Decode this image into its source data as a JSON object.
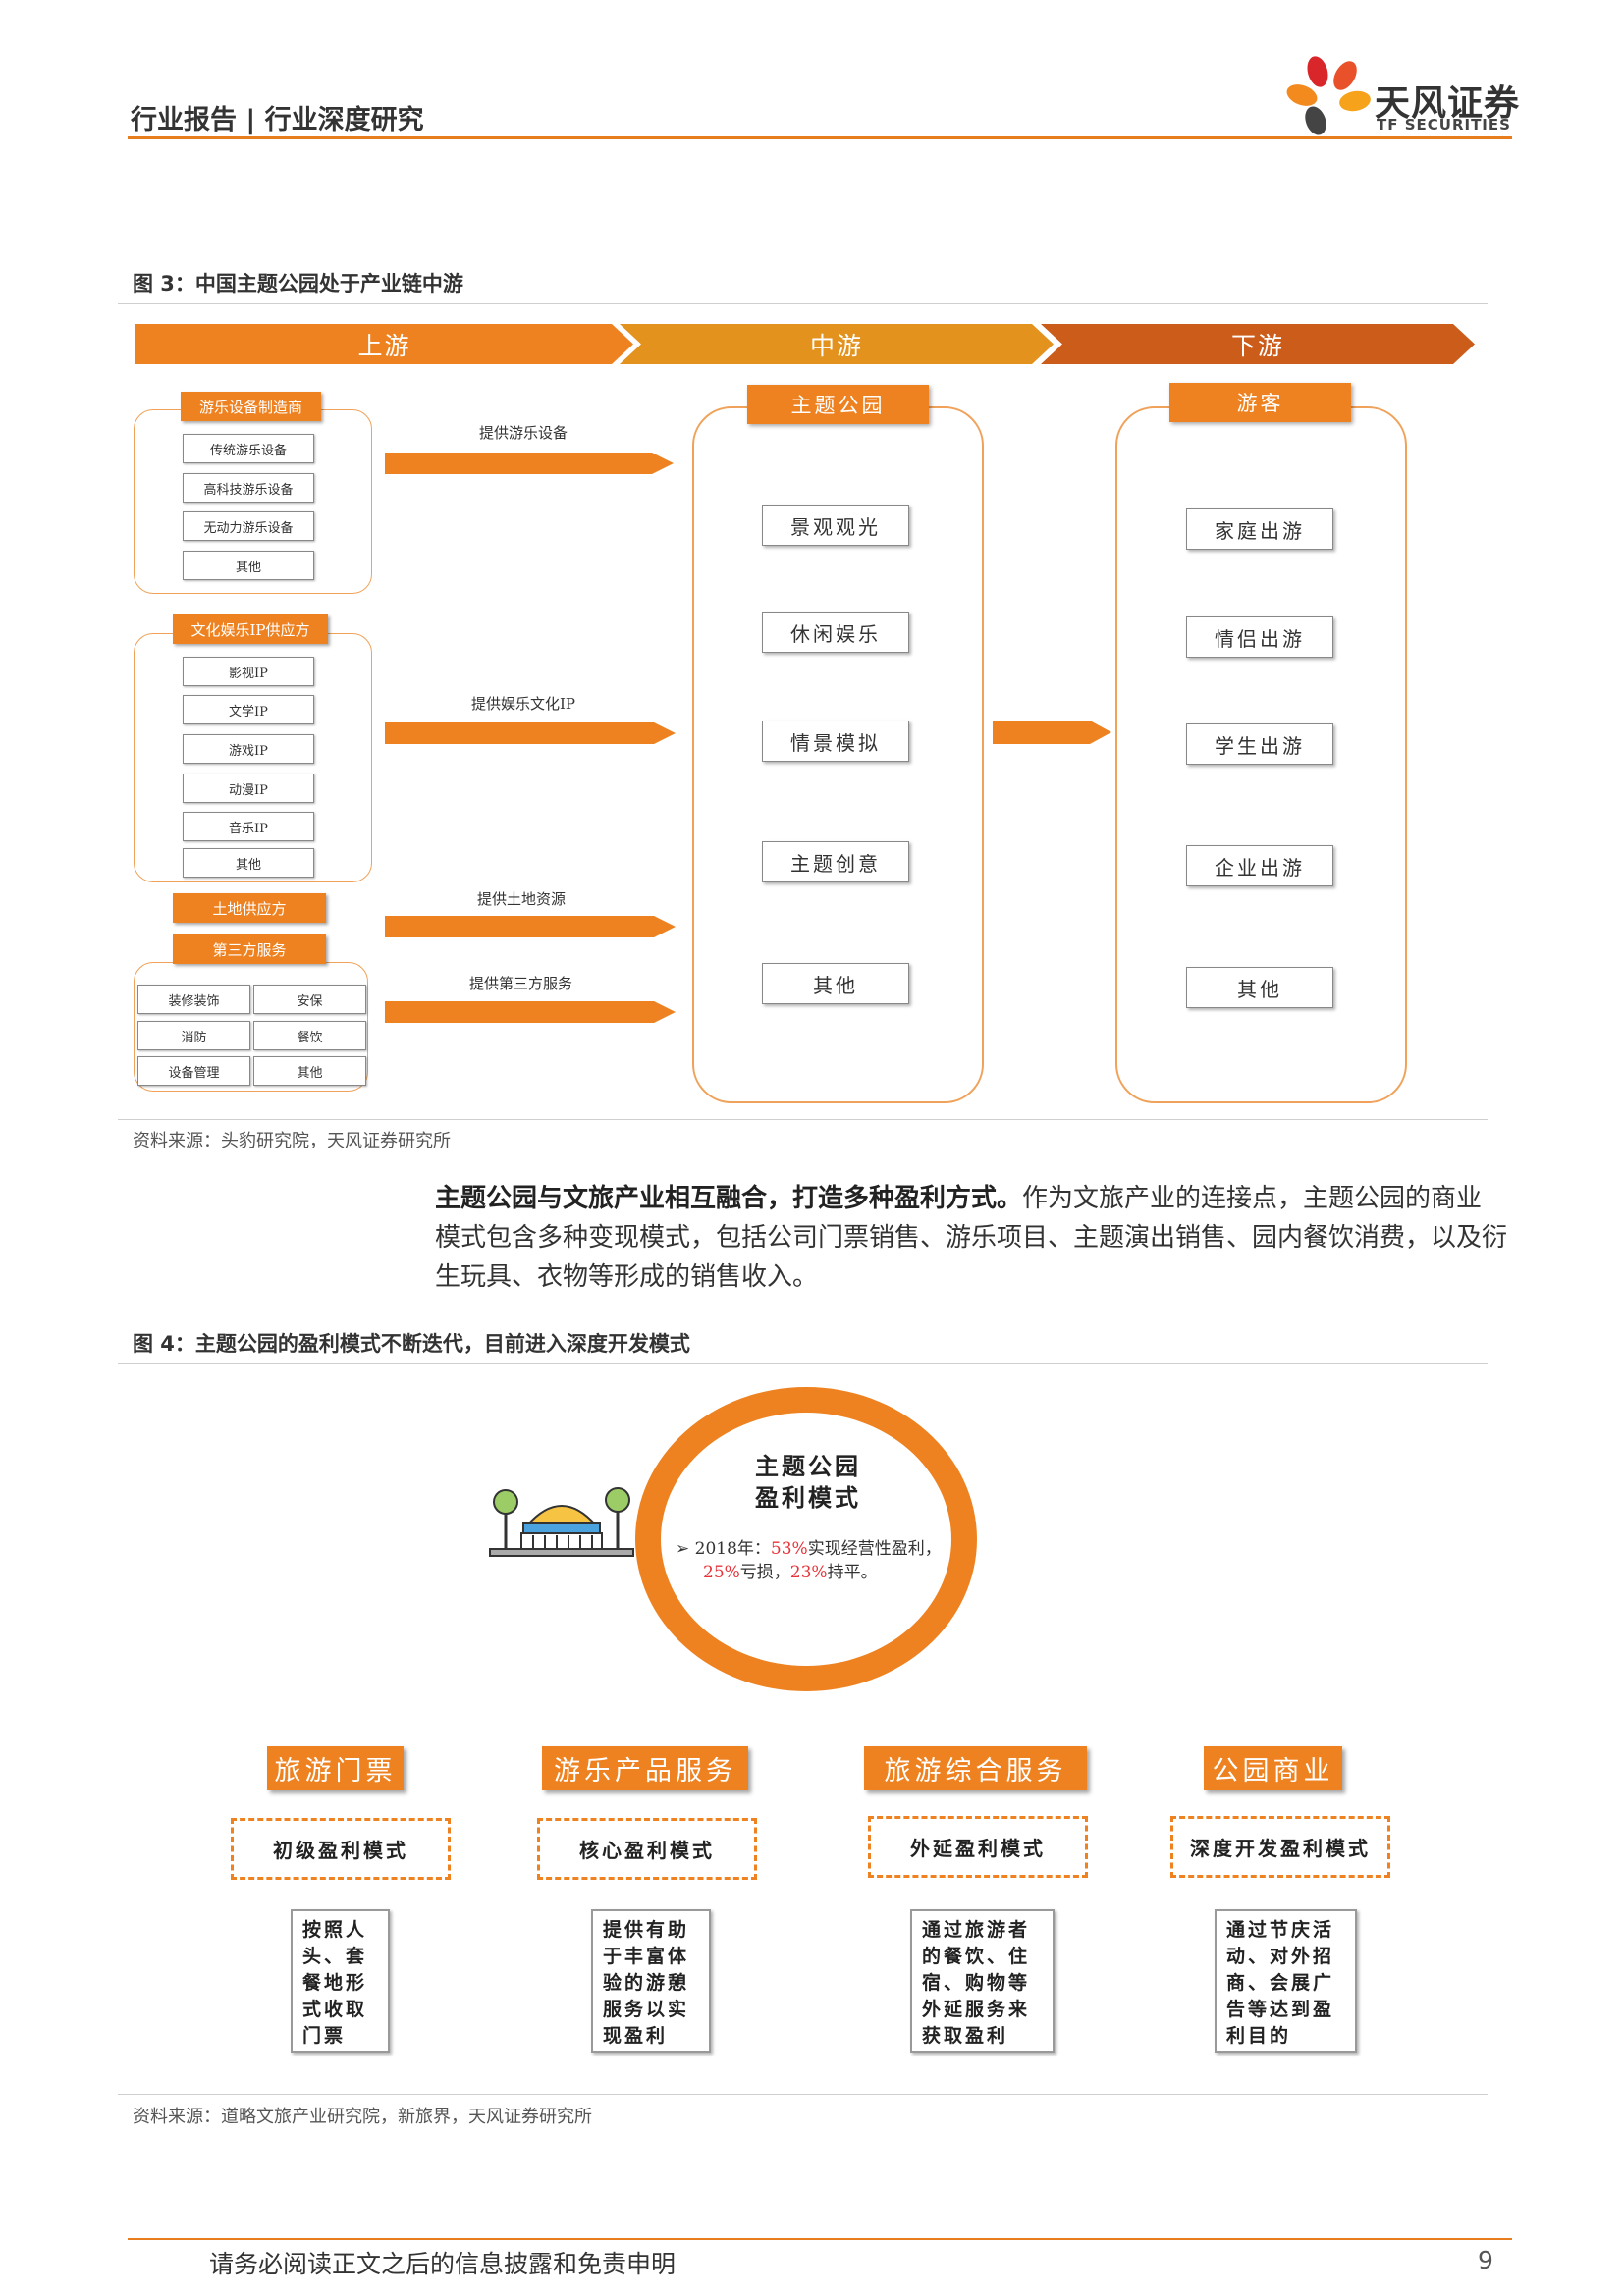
{
  "header": {
    "title": "行业报告 | 行业深度研究",
    "logo_cn": "天风证券",
    "logo_en": "TF SECURITIES",
    "accent": "#e87d1e"
  },
  "figure3": {
    "title": "图 3：中国主题公园处于产业链中游",
    "stages": [
      "上游",
      "中游",
      "下游"
    ],
    "groups": [
      {
        "label": "游乐设备制造商",
        "items": [
          "传统游乐设备",
          "高科技游乐设备",
          "无动力游乐设备",
          "其他"
        ]
      },
      {
        "label": "文化娱乐IP供应方",
        "items": [
          "影视IP",
          "文学IP",
          "游戏IP",
          "动漫IP",
          "音乐IP",
          "其他"
        ]
      },
      {
        "label": "土地供应方",
        "items": []
      },
      {
        "label": "第三方服务",
        "items": [
          "装修装饰",
          "安保",
          "消防",
          "餐饮",
          "设备管理",
          "其他"
        ]
      }
    ],
    "flows": [
      "提供游乐设备",
      "提供娱乐文化IP",
      "提供土地资源",
      "提供第三方服务"
    ],
    "midstream": {
      "label": "主题公园",
      "items": [
        "景观观光",
        "休闲娱乐",
        "情景模拟",
        "主题创意",
        "其他"
      ]
    },
    "downstream": {
      "label": "游客",
      "items": [
        "家庭出游",
        "情侣出游",
        "学生出游",
        "企业出游",
        "其他"
      ]
    },
    "source": "资料来源：头豹研究院，天风证券研究所"
  },
  "paragraph": {
    "lead": "主题公园与文旅产业相互融合，打造多种盈利方式。",
    "body": "作为文旅产业的连接点，主题公园的商业模式包含多种变现模式，包括公司门票销售、游乐项目、主题演出销售、园内餐饮消费，以及衍生玩具、衣物等形成的销售收入。"
  },
  "figure4": {
    "title": "图 4：主题公园的盈利模式不断迭代，目前进入深度开发模式",
    "ring": {
      "title_line1": "主题公园",
      "title_line2": "盈利模式",
      "bullet": "➢",
      "note_prefix": "2018年：",
      "pct1": "53%",
      "note_mid1": "实现经营性盈利，",
      "pct2": "25%",
      "note_mid2": "亏损，",
      "pct3": "23%",
      "note_end": "持平。"
    },
    "columns": [
      {
        "category": "旅游门票",
        "mode": "初级盈利模式",
        "desc": "按照人头、套餐地形式收取门票"
      },
      {
        "category": "游乐产品服务",
        "mode": "核心盈利模式",
        "desc": "提供有助于丰富体验的游憩服务以实现盈利"
      },
      {
        "category": "旅游综合服务",
        "mode": "外延盈利模式",
        "desc": "通过旅游者的餐饮、住宿、购物等外延服务来获取盈利"
      },
      {
        "category": "公园商业",
        "mode": "深度开发盈利模式",
        "desc": "通过节庆活动、对外招商、会展广告等达到盈利目的"
      }
    ],
    "source": "资料来源：道略文旅产业研究院，新旅界，天风证券研究所"
  },
  "footer": {
    "disclaimer": "请务必阅读正文之后的信息披露和免责申明",
    "page": "9"
  }
}
